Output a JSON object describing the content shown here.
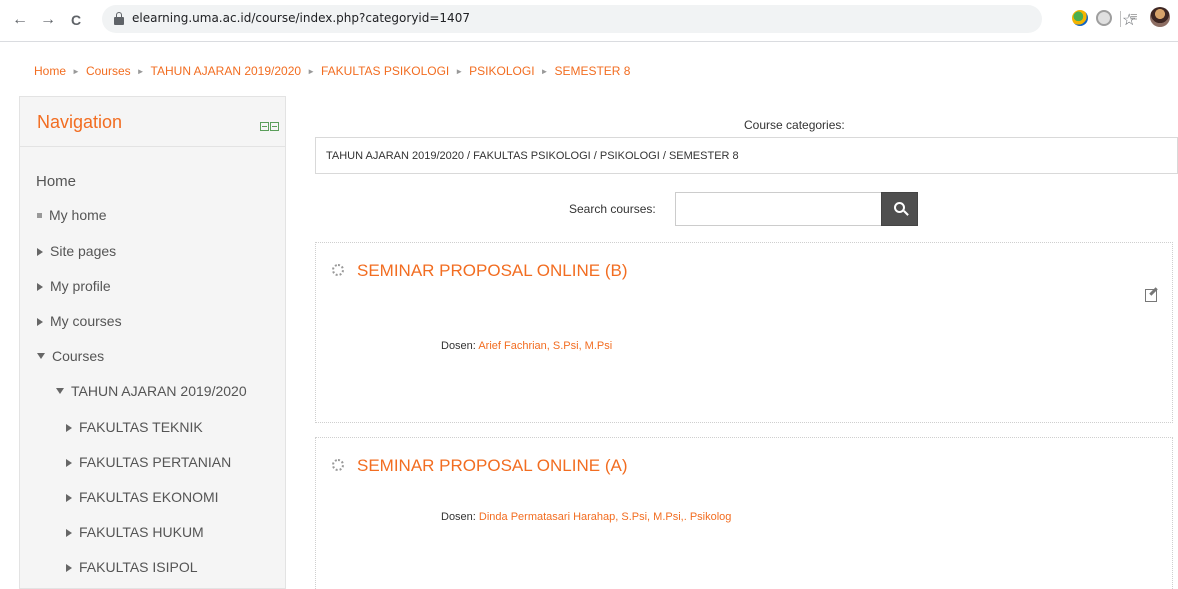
{
  "browser": {
    "url": "elearning.uma.ac.id/course/index.php?categoryid=1407",
    "back_glyph": "←",
    "forward_glyph": "→",
    "reload_glyph": "C",
    "star_glyph": "☆",
    "reader_glyph": "≡"
  },
  "breadcrumb": [
    "Home",
    "Courses",
    "TAHUN AJARAN 2019/2020",
    "FAKULTAS PSIKOLOGI",
    "PSIKOLOGI",
    "SEMESTER 8"
  ],
  "breadcrumb_separator": "►",
  "navigation": {
    "title": "Navigation",
    "home": "Home",
    "my_home": "My home",
    "site_pages": "Site pages",
    "my_profile": "My profile",
    "my_courses": "My courses",
    "courses": "Courses",
    "year": "TAHUN AJARAN 2019/2020",
    "faculties": [
      "FAKULTAS TEKNIK",
      "FAKULTAS PERTANIAN",
      "FAKULTAS EKONOMI",
      "FAKULTAS HUKUM",
      "FAKULTAS ISIPOL"
    ]
  },
  "categories": {
    "label": "Course categories:",
    "selected": "TAHUN AJARAN 2019/2020 / FAKULTAS PSIKOLOGI / PSIKOLOGI / SEMESTER 8"
  },
  "search": {
    "label": "Search courses:",
    "value": ""
  },
  "courses": [
    {
      "title": "SEMINAR PROPOSAL ONLINE (B)",
      "teacher_role": "Dosen:",
      "teacher_name": "Arief Fachrian, S.Psi, M.Psi"
    },
    {
      "title": "SEMINAR PROPOSAL ONLINE (A)",
      "teacher_role": "Dosen:",
      "teacher_name": "Dinda Permatasari Harahap, S.Psi, M.Psi,. Psikolog"
    }
  ],
  "colors": {
    "accent": "#f26d21",
    "nav_bg": "#f5f5f5",
    "search_button": "#4f4f4f"
  }
}
